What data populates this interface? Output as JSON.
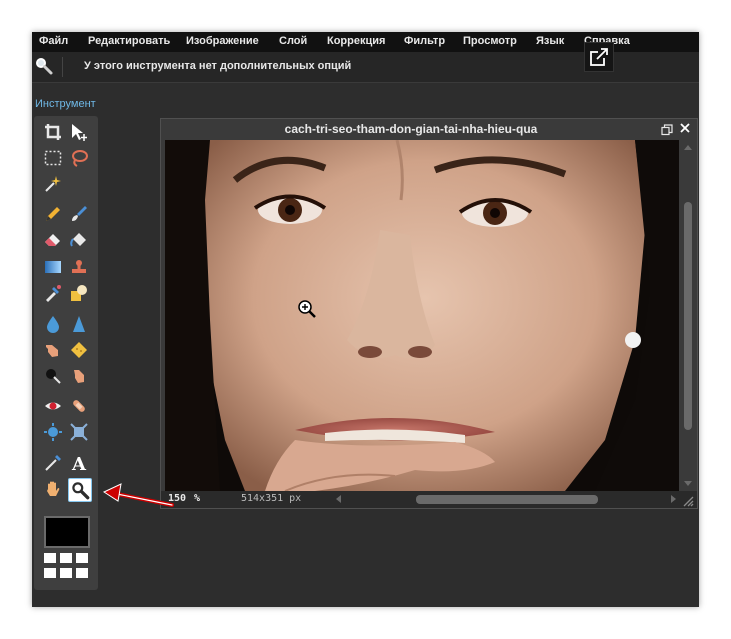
{
  "menu": {
    "items": [
      "Файл",
      "Редактировать",
      "Изображение",
      "Слой",
      "Коррекция",
      "Фильтр",
      "Просмотр",
      "Язык",
      "Справка"
    ]
  },
  "options_bar": {
    "message": "У этого инструмента нет дополнительных опций"
  },
  "toolbox": {
    "label": "Инструмент",
    "active_tool": "zoom-tool",
    "foreground_color": "#000000"
  },
  "image_window": {
    "title": "cach-tri-seo-tham-don-gian-tai-nha-hieu-qua",
    "zoom_value": "150",
    "zoom_unit": "%",
    "dimensions": "514x351 px"
  },
  "colors": {
    "menubar_bg": "#111111",
    "app_bg": "#2d2d2d",
    "accent_label": "#6fb8e6",
    "callout_arrow": "#cc0000"
  }
}
